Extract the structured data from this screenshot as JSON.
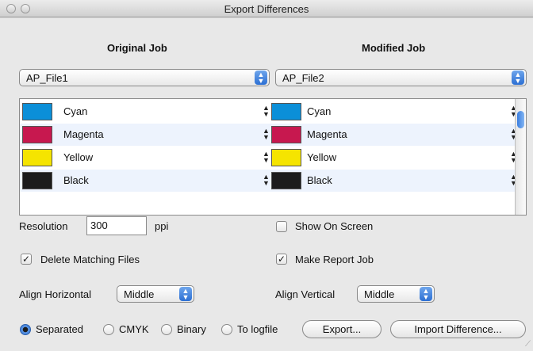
{
  "window": {
    "title": "Export Differences"
  },
  "columns": {
    "original": "Original Job",
    "modified": "Modified Job"
  },
  "jobs": {
    "original": "AP_File1",
    "modified": "AP_File2"
  },
  "separations": [
    {
      "name": "Cyan",
      "color": "#0b8fd8"
    },
    {
      "name": "Magenta",
      "color": "#c7184f"
    },
    {
      "name": "Yellow",
      "color": "#f5e400"
    },
    {
      "name": "Black",
      "color": "#1c1c1c"
    }
  ],
  "resolution": {
    "label": "Resolution",
    "value": "300",
    "unit": "ppi"
  },
  "options": {
    "show_on_screen": "Show On Screen",
    "delete_matching": "Delete Matching Files",
    "make_report": "Make Report Job"
  },
  "states": {
    "show_on_screen": false,
    "delete_matching": true,
    "make_report": true
  },
  "align": {
    "horizontal_label": "Align Horizontal",
    "horizontal_value": "Middle",
    "vertical_label": "Align Vertical",
    "vertical_value": "Middle"
  },
  "output": {
    "separated": "Separated",
    "cmyk": "CMYK",
    "binary": "Binary",
    "logfile": "To logfile",
    "selected": "Separated"
  },
  "buttons": {
    "export": "Export...",
    "import": "Import Difference..."
  }
}
